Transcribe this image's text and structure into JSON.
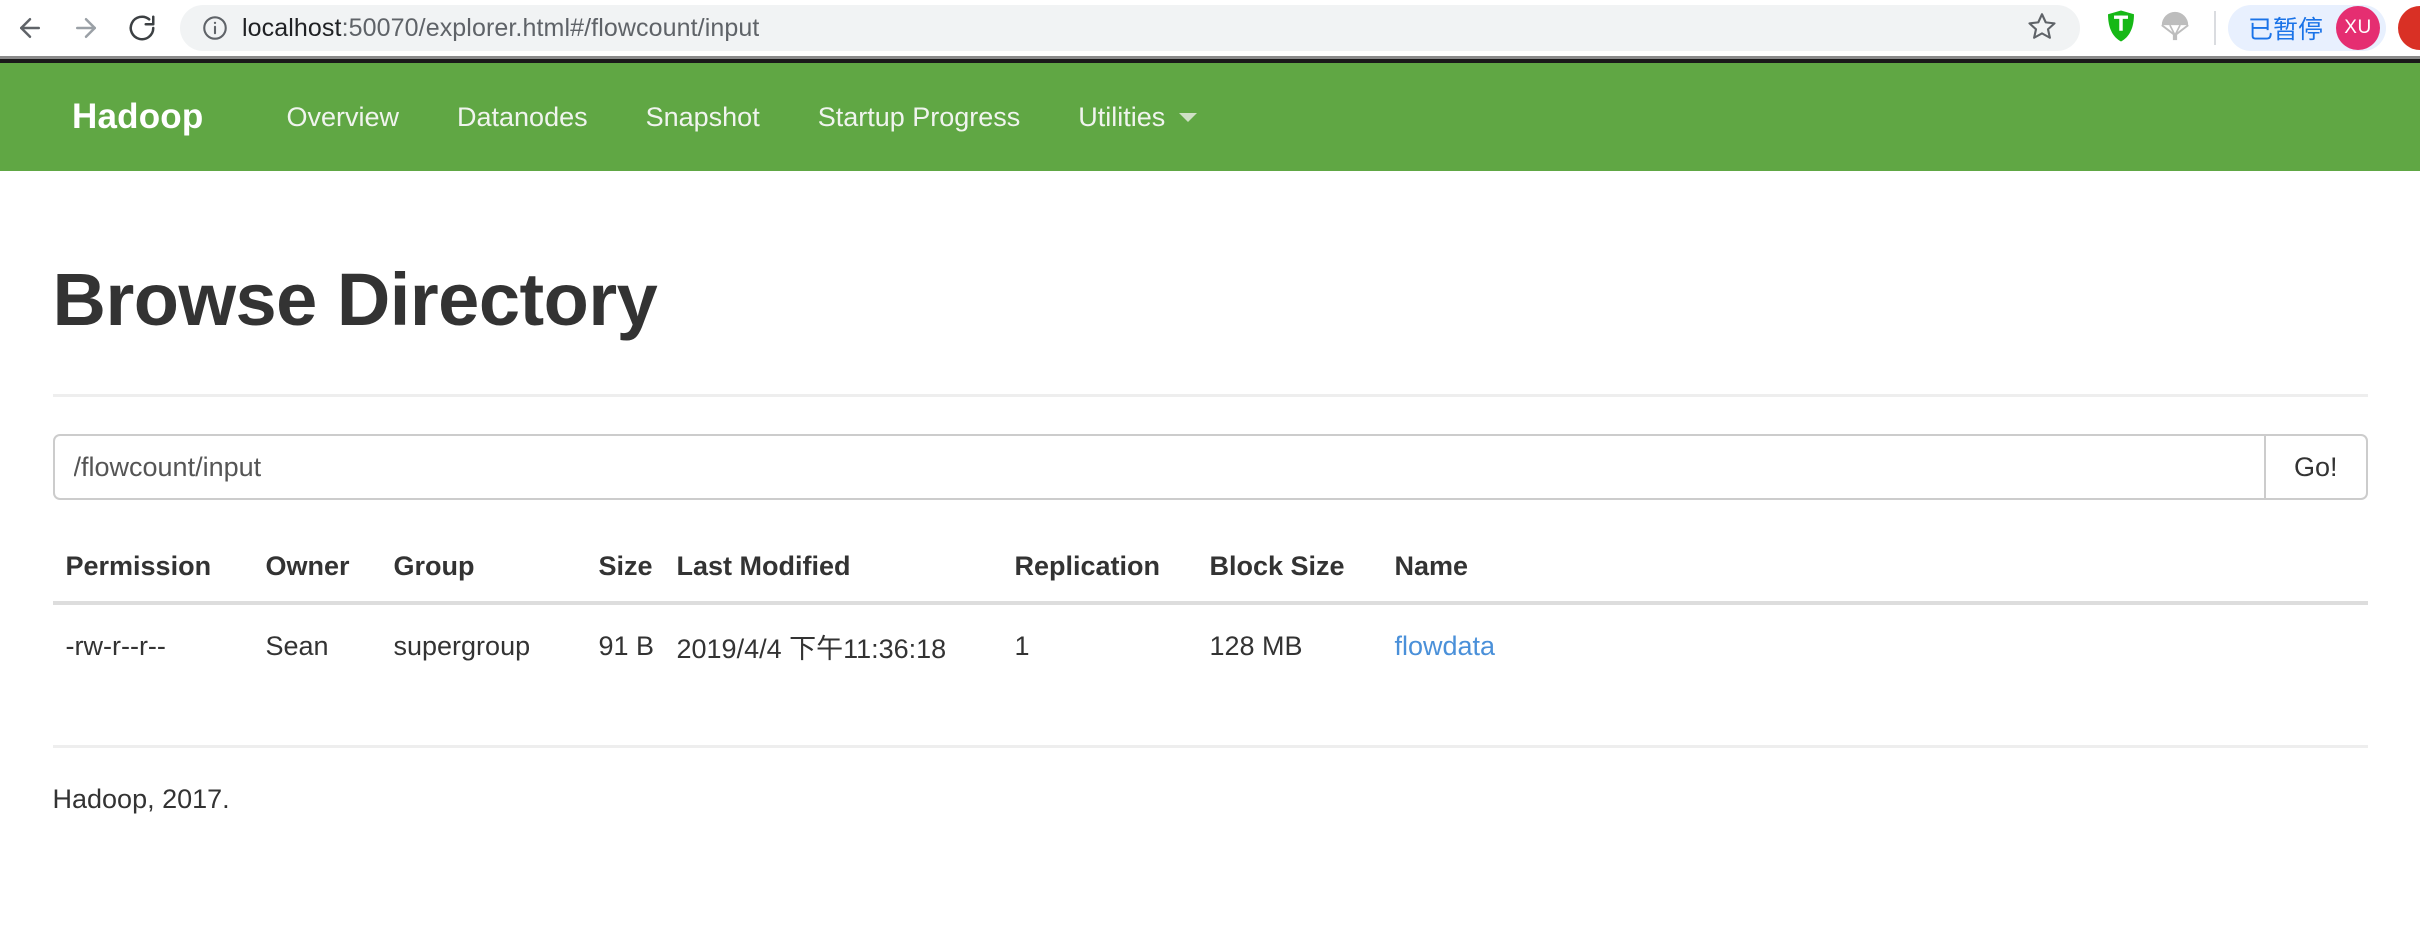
{
  "browser": {
    "back_icon": "back-arrow-icon",
    "forward_icon": "forward-arrow-icon",
    "reload_icon": "reload-icon",
    "site_info_icon": "site-info-icon",
    "url_host": "localhost",
    "url_rest": ":50070/explorer.html#/flowcount/input",
    "url_full": "localhost:50070/explorer.html#/flowcount/input",
    "bookmark_icon": "star-outline-icon",
    "extensions": [
      {
        "name": "shield-t-extension-icon",
        "letter": "T",
        "color": "#16b816"
      },
      {
        "name": "parachute-extension-icon",
        "color": "#b8b8b8"
      }
    ],
    "profile": {
      "status_label": "已暂停",
      "avatar_initials": "XU",
      "avatar_color": "#e52e71",
      "pill_bg": "#e8f0fe",
      "pill_text_color": "#1a73e8"
    }
  },
  "navbar": {
    "brand": "Hadoop",
    "background": "#60a744",
    "links": [
      {
        "label": "Overview",
        "has_caret": false
      },
      {
        "label": "Datanodes",
        "has_caret": false
      },
      {
        "label": "Snapshot",
        "has_caret": false
      },
      {
        "label": "Startup Progress",
        "has_caret": false
      },
      {
        "label": "Utilities",
        "has_caret": true
      }
    ]
  },
  "main": {
    "title": "Browse Directory",
    "path_input": {
      "value": "/flowcount/input",
      "placeholder": "/"
    },
    "go_label": "Go!",
    "table": {
      "headers": [
        "Permission",
        "Owner",
        "Group",
        "Size",
        "Last Modified",
        "Replication",
        "Block Size",
        "Name"
      ],
      "rows": [
        {
          "permission": "-rw-r--r--",
          "owner": "Sean",
          "group": "supergroup",
          "size": "91 B",
          "last_modified": "2019/4/4 下午11:36:18",
          "replication": "1",
          "block_size": "128 MB",
          "name": "flowdata"
        }
      ]
    }
  },
  "footer": {
    "text": "Hadoop, 2017."
  },
  "colors": {
    "brand_green": "#60a744",
    "link_blue": "#4a90d9",
    "text_dark": "#333333"
  }
}
